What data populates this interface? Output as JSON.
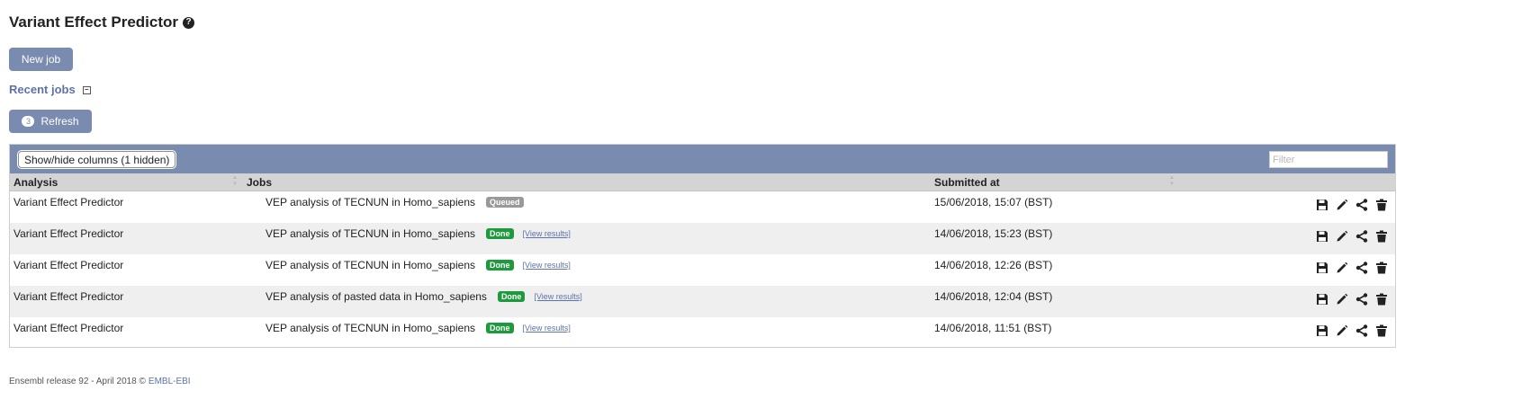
{
  "page": {
    "title": "Variant Effect Predictor",
    "help_icon": "question-circle-icon"
  },
  "buttons": {
    "new_job": "New job",
    "refresh": "Refresh",
    "refresh_count": "3"
  },
  "recent_jobs": {
    "label": "Recent jobs",
    "toggle_icon": "collapse-minus-icon"
  },
  "table": {
    "show_hide_label": "Show/hide columns (1 hidden)",
    "filter_placeholder": "Filter",
    "columns": [
      "Analysis",
      "Jobs",
      "Submitted at"
    ],
    "view_results_label": "[View results]",
    "rows": [
      {
        "analysis": "Variant Effect Predictor",
        "job": "VEP analysis of TECNUN in Homo_sapiens",
        "status": "Queued",
        "submitted": "15/06/2018, 15:07 (BST)"
      },
      {
        "analysis": "Variant Effect Predictor",
        "job": "VEP analysis of TECNUN in Homo_sapiens",
        "status": "Done",
        "submitted": "14/06/2018, 15:23 (BST)"
      },
      {
        "analysis": "Variant Effect Predictor",
        "job": "VEP analysis of TECNUN in Homo_sapiens",
        "status": "Done",
        "submitted": "14/06/2018, 12:26 (BST)"
      },
      {
        "analysis": "Variant Effect Predictor",
        "job": "VEP analysis of pasted data in Homo_sapiens",
        "status": "Done",
        "submitted": "14/06/2018, 12:04 (BST)"
      },
      {
        "analysis": "Variant Effect Predictor",
        "job": "VEP analysis of TECNUN in Homo_sapiens",
        "status": "Done",
        "submitted": "14/06/2018, 11:51 (BST)"
      }
    ],
    "row_actions": [
      "save-icon",
      "edit-pencil-icon",
      "share-icon",
      "trash-icon"
    ]
  },
  "colors": {
    "accent": "#7a8bb0",
    "link": "#5b72ad",
    "done_badge": "#1d9b3c",
    "queued_badge": "#999999"
  },
  "footer": {
    "text": "Ensembl release 92 - April 2018 ©",
    "link": "EMBL-EBI"
  }
}
